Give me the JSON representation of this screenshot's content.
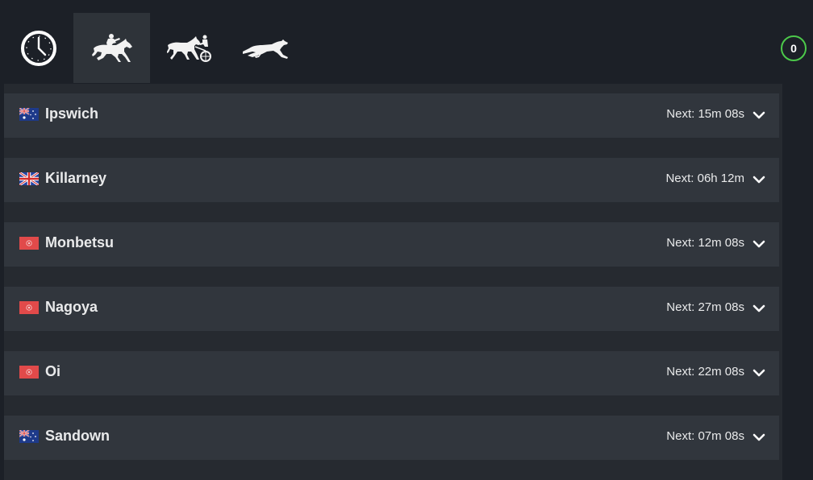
{
  "tabs": [
    {
      "id": "next-to-go",
      "icon": "clock-icon"
    },
    {
      "id": "horse-racing",
      "icon": "horse-jockey-icon",
      "active": true
    },
    {
      "id": "harness-racing",
      "icon": "harness-sulky-icon"
    },
    {
      "id": "greyhound-racing",
      "icon": "greyhound-icon"
    }
  ],
  "bet_count": "0",
  "colors": {
    "background": "#1c2027",
    "row": "#31363d",
    "active_tab": "#2e3339",
    "badge_ring": "#4cc94a",
    "text": "#e9eaeb"
  },
  "meetings": [
    {
      "name": "Ipswich",
      "flag": "australia-flag",
      "next": "Next: 15m 08s"
    },
    {
      "name": "Killarney",
      "flag": "uk-flag",
      "next": "Next: 06h 12m"
    },
    {
      "name": "Monbetsu",
      "flag": "japan-flag",
      "next": "Next: 12m 08s"
    },
    {
      "name": "Nagoya",
      "flag": "japan-flag",
      "next": "Next: 27m 08s"
    },
    {
      "name": "Oi",
      "flag": "japan-flag",
      "next": "Next: 22m 08s"
    },
    {
      "name": "Sandown",
      "flag": "australia-flag",
      "next": "Next: 07m 08s"
    }
  ]
}
